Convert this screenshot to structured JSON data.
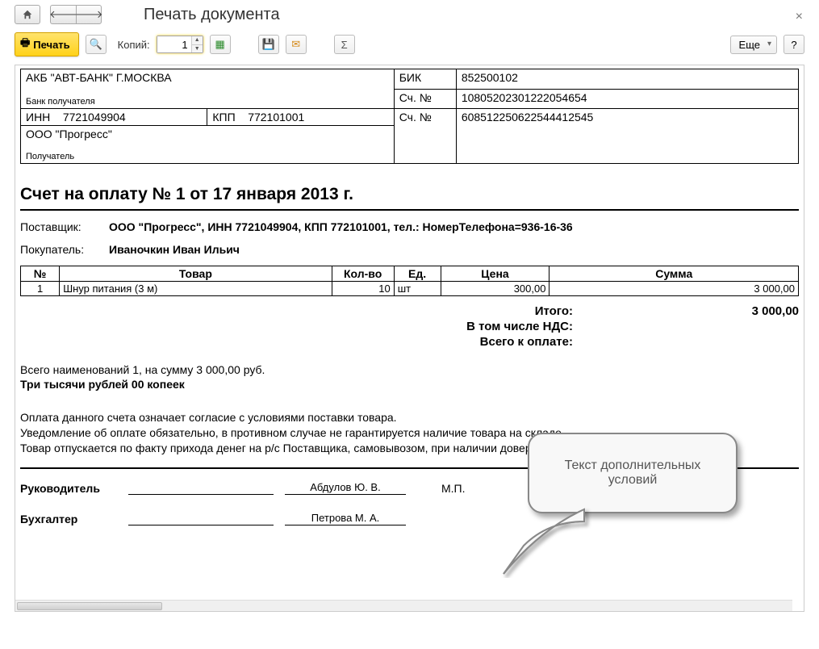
{
  "header": {
    "title": "Печать документа"
  },
  "toolbar": {
    "print_label": "Печать",
    "copies_label": "Копий:",
    "copies_value": "1",
    "more_label": "Еще",
    "help_label": "?"
  },
  "bank": {
    "bank_name": "АКБ \"АВТ-БАНК\" Г.МОСКВА",
    "bank_recipient_label": "Банк получателя",
    "bik_label": "БИК",
    "bik_value": "852500102",
    "acc_label": "Сч. №",
    "bank_acc": "10805202301222054654",
    "inn_label": "ИНН",
    "inn_value": "7721049904",
    "kpp_label": "КПП",
    "kpp_value": "772101001",
    "acc_label2": "Сч. №",
    "payer_acc": "608512250622544412545",
    "org_name": "ООО \"Прогресс\"",
    "recipient_label": "Получатель"
  },
  "headline": "Счет на оплату № 1 от 17 января 2013 г.",
  "supplier_label": "Поставщик:",
  "supplier_value": "ООО \"Прогресс\", ИНН 7721049904, КПП 772101001,  тел.: НомерТелефона=936-16-36",
  "buyer_label": "Покупатель:",
  "buyer_value": "Иваночкин Иван Ильич",
  "items_header": {
    "num": "№",
    "name": "Товар",
    "qty": "Кол-во",
    "unit": "Ед.",
    "price": "Цена",
    "sum": "Сумма"
  },
  "items": [
    {
      "num": "1",
      "name": "Шнур питания (3 м)",
      "qty": "10",
      "unit": "шт",
      "price": "300,00",
      "sum": "3 000,00"
    }
  ],
  "totals": {
    "itogo_label": "Итого:",
    "itogo_value": "3 000,00",
    "nds_label": "В том числе НДС:",
    "nds_value": "",
    "total_label": "Всего к оплате:",
    "total_value": ""
  },
  "summary_line": "Всего наименований 1, на сумму 3 000,00 руб.",
  "summary_words": "Три тысячи рублей 00 копеек",
  "conditions": {
    "l1": "Оплата данного счета означает согласие с условиями поставки товара.",
    "l2": "Уведомление об оплате обязательно, в противном случае не гарантируется наличие товара на складе.",
    "l3": "Товар отпускается по факту прихода денег на р/с Поставщика, самовывозом, при наличии доверенности и паспорта."
  },
  "signatures": {
    "director_label": "Руководитель",
    "director_name": "Абдулов Ю. В.",
    "mp": "М.П.",
    "accountant_label": "Бухгалтер",
    "accountant_name": "Петрова М. А."
  },
  "callout_text": "Текст дополнительных условий"
}
